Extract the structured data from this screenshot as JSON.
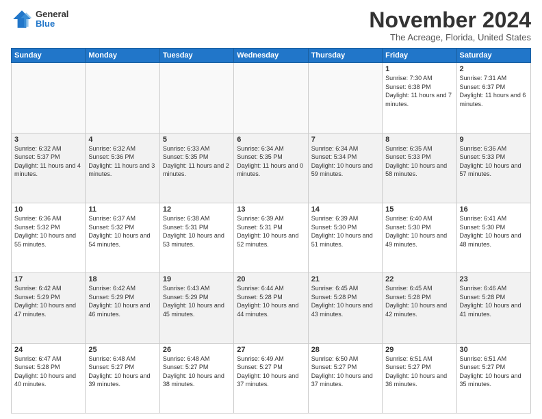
{
  "logo": {
    "general": "General",
    "blue": "Blue"
  },
  "header": {
    "month": "November 2024",
    "location": "The Acreage, Florida, United States"
  },
  "weekdays": [
    "Sunday",
    "Monday",
    "Tuesday",
    "Wednesday",
    "Thursday",
    "Friday",
    "Saturday"
  ],
  "weeks": [
    [
      {
        "day": "",
        "info": ""
      },
      {
        "day": "",
        "info": ""
      },
      {
        "day": "",
        "info": ""
      },
      {
        "day": "",
        "info": ""
      },
      {
        "day": "",
        "info": ""
      },
      {
        "day": "1",
        "info": "Sunrise: 7:30 AM\nSunset: 6:38 PM\nDaylight: 11 hours and 7 minutes."
      },
      {
        "day": "2",
        "info": "Sunrise: 7:31 AM\nSunset: 6:37 PM\nDaylight: 11 hours and 6 minutes."
      }
    ],
    [
      {
        "day": "3",
        "info": "Sunrise: 6:32 AM\nSunset: 5:37 PM\nDaylight: 11 hours and 4 minutes."
      },
      {
        "day": "4",
        "info": "Sunrise: 6:32 AM\nSunset: 5:36 PM\nDaylight: 11 hours and 3 minutes."
      },
      {
        "day": "5",
        "info": "Sunrise: 6:33 AM\nSunset: 5:35 PM\nDaylight: 11 hours and 2 minutes."
      },
      {
        "day": "6",
        "info": "Sunrise: 6:34 AM\nSunset: 5:35 PM\nDaylight: 11 hours and 0 minutes."
      },
      {
        "day": "7",
        "info": "Sunrise: 6:34 AM\nSunset: 5:34 PM\nDaylight: 10 hours and 59 minutes."
      },
      {
        "day": "8",
        "info": "Sunrise: 6:35 AM\nSunset: 5:33 PM\nDaylight: 10 hours and 58 minutes."
      },
      {
        "day": "9",
        "info": "Sunrise: 6:36 AM\nSunset: 5:33 PM\nDaylight: 10 hours and 57 minutes."
      }
    ],
    [
      {
        "day": "10",
        "info": "Sunrise: 6:36 AM\nSunset: 5:32 PM\nDaylight: 10 hours and 55 minutes."
      },
      {
        "day": "11",
        "info": "Sunrise: 6:37 AM\nSunset: 5:32 PM\nDaylight: 10 hours and 54 minutes."
      },
      {
        "day": "12",
        "info": "Sunrise: 6:38 AM\nSunset: 5:31 PM\nDaylight: 10 hours and 53 minutes."
      },
      {
        "day": "13",
        "info": "Sunrise: 6:39 AM\nSunset: 5:31 PM\nDaylight: 10 hours and 52 minutes."
      },
      {
        "day": "14",
        "info": "Sunrise: 6:39 AM\nSunset: 5:30 PM\nDaylight: 10 hours and 51 minutes."
      },
      {
        "day": "15",
        "info": "Sunrise: 6:40 AM\nSunset: 5:30 PM\nDaylight: 10 hours and 49 minutes."
      },
      {
        "day": "16",
        "info": "Sunrise: 6:41 AM\nSunset: 5:30 PM\nDaylight: 10 hours and 48 minutes."
      }
    ],
    [
      {
        "day": "17",
        "info": "Sunrise: 6:42 AM\nSunset: 5:29 PM\nDaylight: 10 hours and 47 minutes."
      },
      {
        "day": "18",
        "info": "Sunrise: 6:42 AM\nSunset: 5:29 PM\nDaylight: 10 hours and 46 minutes."
      },
      {
        "day": "19",
        "info": "Sunrise: 6:43 AM\nSunset: 5:29 PM\nDaylight: 10 hours and 45 minutes."
      },
      {
        "day": "20",
        "info": "Sunrise: 6:44 AM\nSunset: 5:28 PM\nDaylight: 10 hours and 44 minutes."
      },
      {
        "day": "21",
        "info": "Sunrise: 6:45 AM\nSunset: 5:28 PM\nDaylight: 10 hours and 43 minutes."
      },
      {
        "day": "22",
        "info": "Sunrise: 6:45 AM\nSunset: 5:28 PM\nDaylight: 10 hours and 42 minutes."
      },
      {
        "day": "23",
        "info": "Sunrise: 6:46 AM\nSunset: 5:28 PM\nDaylight: 10 hours and 41 minutes."
      }
    ],
    [
      {
        "day": "24",
        "info": "Sunrise: 6:47 AM\nSunset: 5:28 PM\nDaylight: 10 hours and 40 minutes."
      },
      {
        "day": "25",
        "info": "Sunrise: 6:48 AM\nSunset: 5:27 PM\nDaylight: 10 hours and 39 minutes."
      },
      {
        "day": "26",
        "info": "Sunrise: 6:48 AM\nSunset: 5:27 PM\nDaylight: 10 hours and 38 minutes."
      },
      {
        "day": "27",
        "info": "Sunrise: 6:49 AM\nSunset: 5:27 PM\nDaylight: 10 hours and 37 minutes."
      },
      {
        "day": "28",
        "info": "Sunrise: 6:50 AM\nSunset: 5:27 PM\nDaylight: 10 hours and 37 minutes."
      },
      {
        "day": "29",
        "info": "Sunrise: 6:51 AM\nSunset: 5:27 PM\nDaylight: 10 hours and 36 minutes."
      },
      {
        "day": "30",
        "info": "Sunrise: 6:51 AM\nSunset: 5:27 PM\nDaylight: 10 hours and 35 minutes."
      }
    ]
  ]
}
